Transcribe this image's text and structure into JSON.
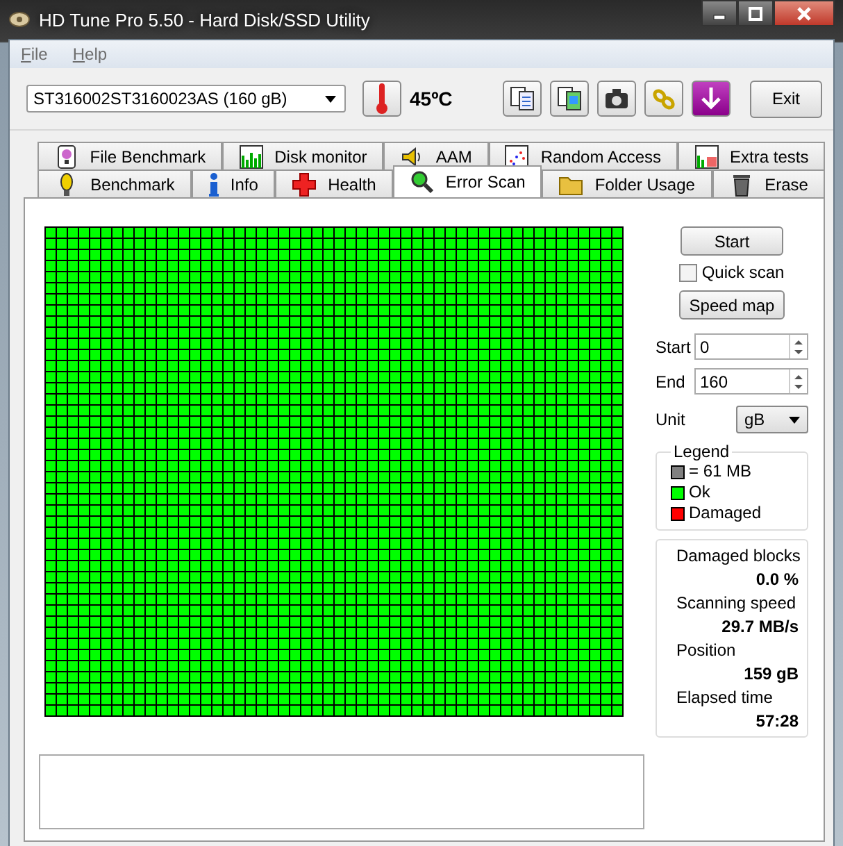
{
  "window": {
    "title": "HD Tune Pro 5.50 - Hard Disk/SSD Utility"
  },
  "menu": [
    {
      "label": "File"
    },
    {
      "label": "Help"
    }
  ],
  "toolbar": {
    "drive": "ST316002ST3160023AS (160 gB)",
    "temperature": "45ºC",
    "tools": [
      {
        "kind": "copy"
      },
      {
        "kind": "copy-image"
      },
      {
        "kind": "camera"
      },
      {
        "kind": "chain"
      },
      {
        "kind": "save"
      }
    ],
    "exit": "Exit"
  },
  "tabs_back": [
    {
      "label": "File Benchmark",
      "kind": "bulb-file",
      "selected": false
    },
    {
      "label": "Disk monitor",
      "kind": "bars",
      "selected": false
    },
    {
      "label": "AAM",
      "kind": "speaker",
      "selected": false
    },
    {
      "label": "Random Access",
      "kind": "scatter",
      "selected": false
    },
    {
      "label": "Extra tests",
      "kind": "bars-grid",
      "selected": false
    }
  ],
  "tabs_front": [
    {
      "label": "Benchmark",
      "kind": "bulb",
      "selected": false
    },
    {
      "label": "Info",
      "kind": "info",
      "selected": false
    },
    {
      "label": "Health",
      "kind": "cross",
      "selected": false
    },
    {
      "label": "Error Scan",
      "kind": "magnifier",
      "selected": true
    },
    {
      "label": "Folder Usage",
      "kind": "folder",
      "selected": false
    },
    {
      "label": "Erase",
      "kind": "trash",
      "selected": false
    }
  ],
  "scan_map": {
    "level": 1
  },
  "controls": {
    "start_button": "Start",
    "quick_scan": {
      "label": "Quick scan",
      "checked": false
    },
    "speed_map_button": "Speed map",
    "start": {
      "label": "Start",
      "value": "0"
    },
    "end": {
      "label": "End",
      "value": "160"
    },
    "unit": {
      "label": "Unit",
      "value": "gB"
    }
  },
  "legend": {
    "title": "Legend",
    "items": [
      {
        "label": "= 61 MB",
        "color": "#808080"
      },
      {
        "label": "Ok",
        "color": "#00ff00"
      },
      {
        "label": "Damaged",
        "color": "#ff0000"
      }
    ]
  },
  "stats": [
    {
      "label": "Damaged blocks",
      "value": "0.0 %"
    },
    {
      "label": "Scanning speed",
      "value": "29.7 MB/s"
    },
    {
      "label": "Position",
      "value": "159 gB"
    },
    {
      "label": "Elapsed time",
      "value": "57:28"
    }
  ]
}
